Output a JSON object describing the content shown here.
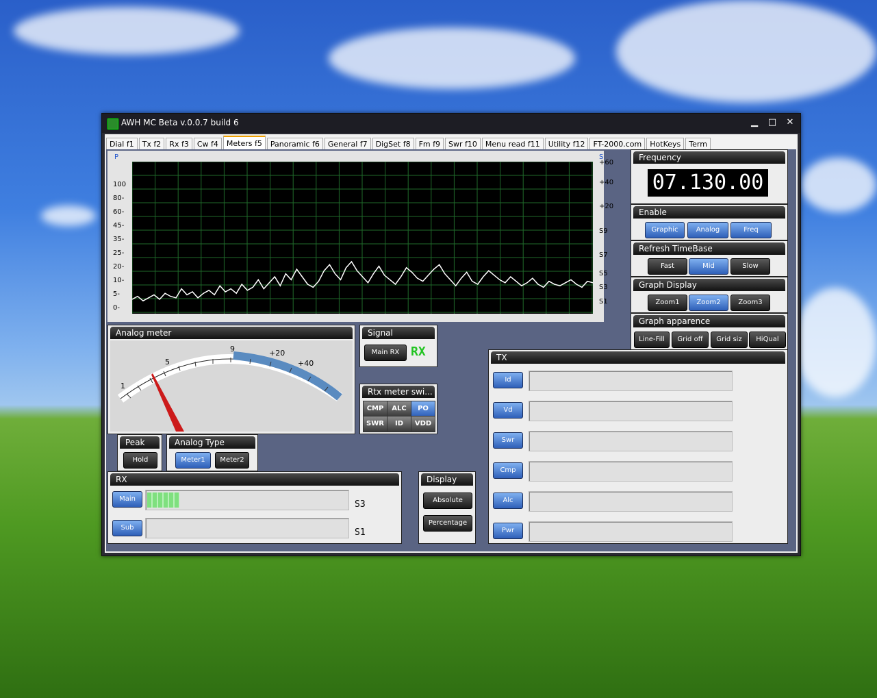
{
  "window": {
    "title": "AWH MC Beta v.0.0.7 build 6",
    "minimize": "▁",
    "maximize": "□",
    "close": "✕"
  },
  "tabs": [
    "Dial  f1",
    "Tx  f2",
    "Rx  f3",
    "Cw  f4",
    "Meters  f5",
    "Panoramic  f6",
    "General  f7",
    "DigSet  f8",
    "Fm  f9",
    "Swr  f10",
    "Menu read  f11",
    "Utility  f12",
    "FT-2000.com",
    "HotKeys",
    "Term"
  ],
  "graph": {
    "left_title": "P",
    "right_title": "S",
    "left_ticks": [
      "100",
      "80-",
      "60-",
      "45-",
      "35-",
      "25-",
      "20-",
      "10-",
      "5-",
      "0-"
    ],
    "right_ticks": [
      "+60",
      "+40",
      "+20",
      "S9",
      "S7",
      "S5",
      "S3",
      "S1"
    ],
    "trace": [
      5,
      7,
      4,
      6,
      8,
      5,
      9,
      7,
      6,
      12,
      8,
      10,
      6,
      9,
      11,
      8,
      14,
      10,
      12,
      9,
      15,
      11,
      13,
      18,
      12,
      16,
      20,
      14,
      22,
      18,
      25,
      20,
      15,
      13,
      17,
      24,
      28,
      22,
      18,
      26,
      30,
      24,
      20,
      16,
      22,
      27,
      21,
      18,
      15,
      20,
      26,
      23,
      19,
      17,
      21,
      25,
      28,
      22,
      18,
      14,
      19,
      23,
      17,
      15,
      20,
      24,
      21,
      18,
      16,
      20,
      17,
      14,
      16,
      19,
      15,
      13,
      17,
      15,
      14,
      16,
      18,
      15,
      13,
      17,
      16
    ]
  },
  "frequency": {
    "title": "Frequency",
    "value": "07.130.00"
  },
  "enable": {
    "title": "Enable",
    "buttons": [
      "Graphic",
      "Analog",
      "Freq"
    ]
  },
  "refresh": {
    "title": "Refresh TimeBase",
    "buttons": [
      "Fast",
      "Mid",
      "Slow"
    ]
  },
  "graph_display": {
    "title": "Graph Display",
    "buttons": [
      "Zoom1",
      "Zoom2",
      "Zoom3"
    ]
  },
  "graph_appearance": {
    "title": "Graph apparence",
    "buttons": [
      "Line-Fill",
      "Grid off",
      "Grid siz",
      "HiQual"
    ]
  },
  "analog_meter": {
    "title": "Analog meter",
    "scale_labels": [
      "1",
      "5",
      "9",
      "+20",
      "+40"
    ],
    "needle_value": "S3"
  },
  "signal": {
    "title": "Signal",
    "button": "Main RX",
    "indicator": "RX"
  },
  "rtx_meter": {
    "title": "Rtx meter swi...",
    "cells": [
      "CMP",
      "ALC",
      "PO",
      "SWR",
      "ID",
      "VDD"
    ]
  },
  "peak": {
    "title": "Peak",
    "button": "Hold"
  },
  "analog_type": {
    "title": "Analog Type",
    "buttons": [
      "Meter1",
      "Meter2"
    ]
  },
  "rx": {
    "title": "RX",
    "main_label": "Main",
    "main_reading": "S3",
    "main_level": 0.16,
    "sub_label": "Sub",
    "sub_reading": "S1",
    "sub_level": 0.0
  },
  "display": {
    "title": "Display",
    "buttons": [
      "Absolute",
      "Percentage"
    ]
  },
  "tx": {
    "title": "TX",
    "rows": [
      "Id",
      "Vd",
      "Swr",
      "Cmp",
      "Alc",
      "Pwr"
    ]
  }
}
